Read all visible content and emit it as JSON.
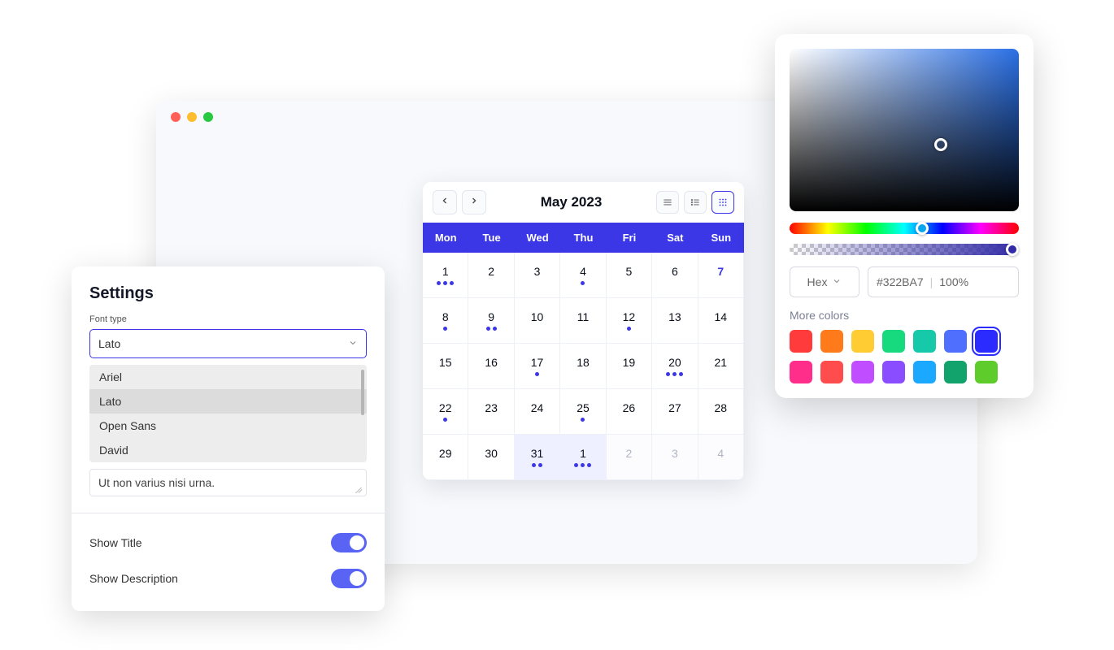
{
  "settings": {
    "title": "Settings",
    "font_type_label": "Font type",
    "selected_font": "Lato",
    "font_options": [
      "Ariel",
      "Lato",
      "Open Sans",
      "David"
    ],
    "textarea_value": "Ut non varius nisi urna.",
    "show_title_label": "Show Title",
    "show_title_on": true,
    "show_description_label": "Show Description",
    "show_description_on": true
  },
  "calendar": {
    "title": "May 2023",
    "weekdays": [
      "Mon",
      "Tue",
      "Wed",
      "Thu",
      "Fri",
      "Sat",
      "Sun"
    ],
    "grid": [
      [
        {
          "d": "1",
          "dots": 3
        },
        {
          "d": "2",
          "dots": 0
        },
        {
          "d": "3",
          "dots": 0
        },
        {
          "d": "4",
          "dots": 1
        },
        {
          "d": "5",
          "dots": 0
        },
        {
          "d": "6",
          "dots": 0
        },
        {
          "d": "7",
          "dots": 0,
          "accent": true
        }
      ],
      [
        {
          "d": "8",
          "dots": 1
        },
        {
          "d": "9",
          "dots": 2
        },
        {
          "d": "10",
          "dots": 0
        },
        {
          "d": "11",
          "dots": 0
        },
        {
          "d": "12",
          "dots": 1
        },
        {
          "d": "13",
          "dots": 0
        },
        {
          "d": "14",
          "dots": 0
        }
      ],
      [
        {
          "d": "15",
          "dots": 0
        },
        {
          "d": "16",
          "dots": 0
        },
        {
          "d": "17",
          "dots": 1
        },
        {
          "d": "18",
          "dots": 0
        },
        {
          "d": "19",
          "dots": 0
        },
        {
          "d": "20",
          "dots": 3
        },
        {
          "d": "21",
          "dots": 0
        }
      ],
      [
        {
          "d": "22",
          "dots": 1
        },
        {
          "d": "23",
          "dots": 0
        },
        {
          "d": "24",
          "dots": 0
        },
        {
          "d": "25",
          "dots": 1
        },
        {
          "d": "26",
          "dots": 0
        },
        {
          "d": "27",
          "dots": 0
        },
        {
          "d": "28",
          "dots": 0
        }
      ],
      [
        {
          "d": "29",
          "dots": 0
        },
        {
          "d": "30",
          "dots": 0
        },
        {
          "d": "31",
          "dots": 2,
          "sel": true
        },
        {
          "d": "1",
          "dots": 3,
          "sel": true
        },
        {
          "d": "2",
          "dots": 0,
          "muted": true
        },
        {
          "d": "3",
          "dots": 0,
          "muted": true
        },
        {
          "d": "4",
          "dots": 0,
          "muted": true
        }
      ]
    ]
  },
  "picker": {
    "format": "Hex",
    "hex": "#322BA7",
    "opacity": "100%",
    "more_label": "More colors",
    "swatches_row1": [
      "#ff3b3b",
      "#ff7a1a",
      "#ffcc33",
      "#17d97e",
      "#16c9a8",
      "#4f6fff",
      "#2b2bff"
    ],
    "swatches_row2": [
      "#ff2e8b",
      "#ff4d4d",
      "#c04dff",
      "#8a4dff",
      "#1aa9ff",
      "#11a36b",
      "#5ecc2b"
    ],
    "selected_swatch_index": 6
  }
}
